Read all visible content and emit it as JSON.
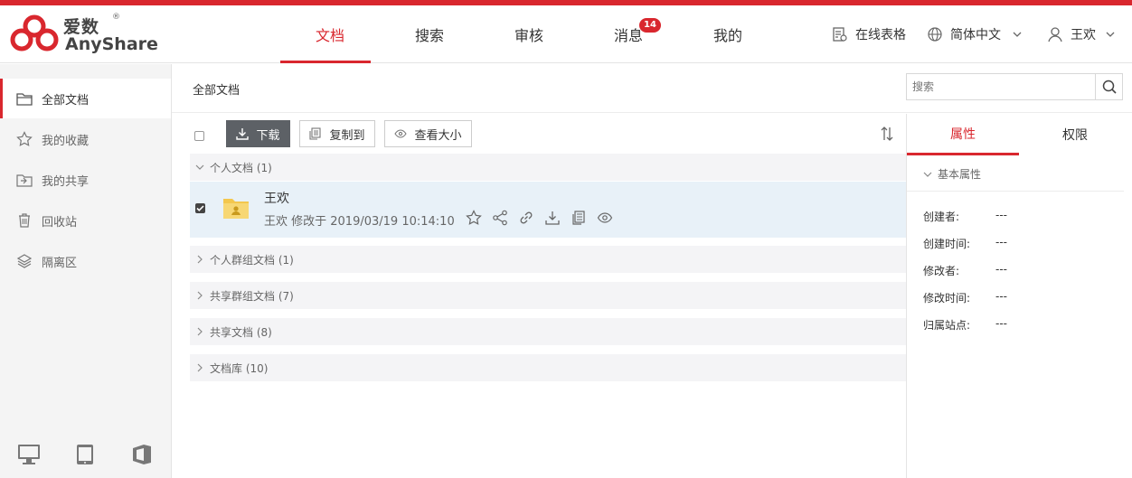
{
  "brand": {
    "name_cn": "爱数",
    "name_en": "AnyShare",
    "reg": "®",
    "accent": "#d9272e"
  },
  "nav": {
    "tabs": [
      {
        "label": "文档",
        "active": true
      },
      {
        "label": "搜索"
      },
      {
        "label": "审核"
      },
      {
        "label": "消息",
        "badge": "14"
      },
      {
        "label": "我的"
      }
    ]
  },
  "header_right": {
    "online_sheet": "在线表格",
    "language": "简体中文",
    "user": "王欢"
  },
  "sidebar": {
    "items": [
      {
        "label": "全部文档",
        "icon": "folder-icon",
        "active": true
      },
      {
        "label": "我的收藏",
        "icon": "star-icon"
      },
      {
        "label": "我的共享",
        "icon": "share-folder-icon"
      },
      {
        "label": "回收站",
        "icon": "trash-icon"
      },
      {
        "label": "隔离区",
        "icon": "layers-icon"
      }
    ],
    "clients": [
      "desktop-icon",
      "tablet-icon",
      "office-icon"
    ]
  },
  "main": {
    "breadcrumb": "全部文档",
    "search_placeholder": "搜索",
    "toolbar": {
      "download": "下载",
      "copy_to": "复制到",
      "view_size": "查看大小"
    },
    "groups": [
      {
        "label": "个人文档 (1)",
        "expanded": true
      },
      {
        "label": "个人群组文档 (1)"
      },
      {
        "label": "共享群组文档 (7)"
      },
      {
        "label": "共享文档 (8)"
      },
      {
        "label": "文档库 (10)"
      }
    ],
    "file": {
      "name": "王欢",
      "meta": "王欢 修改于 2019/03/19 10:14:10",
      "checked": true
    }
  },
  "panel": {
    "tabs": [
      "属性",
      "权限"
    ],
    "section": "基本属性",
    "props": [
      {
        "key": "创建者:",
        "value": "---"
      },
      {
        "key": "创建时间:",
        "value": "---"
      },
      {
        "key": "修改者:",
        "value": "---"
      },
      {
        "key": "修改时间:",
        "value": "---"
      },
      {
        "key": "归属站点:",
        "value": "---"
      }
    ]
  }
}
